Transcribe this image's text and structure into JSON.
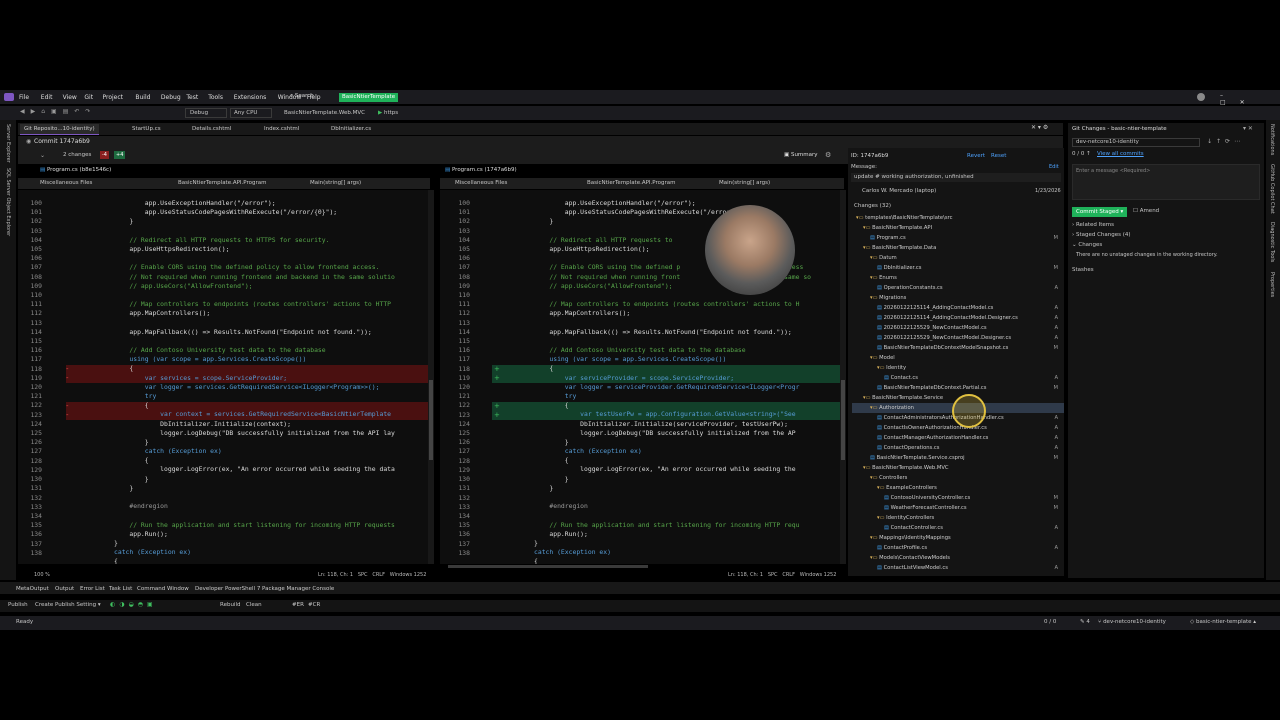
{
  "menu": [
    "File",
    "Edit",
    "View",
    "Git",
    "Project",
    "Build",
    "Debug",
    "Test",
    "Tools",
    "Extensions",
    "Window",
    "Help"
  ],
  "search_label": "Search",
  "solution_badge": "BasicNtierTemplate",
  "toolbar": {
    "config": "Debug",
    "platform": "Any CPU",
    "startup": "BasicNtierTemplate.Web.MVC",
    "run": "https"
  },
  "doc_tabs": [
    {
      "label": "Git Reposito...10-identity)",
      "active": true
    },
    {
      "label": "StartUp.cs",
      "active": false
    },
    {
      "label": "Details.cshtml",
      "active": false
    },
    {
      "label": "Index.cshtml",
      "active": false
    },
    {
      "label": "DbInitializer.cs",
      "active": false
    }
  ],
  "commit": {
    "title": "Commit 1747a6b9",
    "changes": "2 changes",
    "deletions": "-4",
    "additions": "+4",
    "summary": "Summary",
    "id": "ID: 1747a6b9",
    "revert": "Revert",
    "reset": "Reset",
    "message_label": "Message:",
    "message": "update # working authorization, unfinished",
    "edit": "Edit",
    "author": "Carlos W. Mercado (laptop)",
    "date": "1/23/2026",
    "changes_header": "Changes (32)"
  },
  "left_pane": {
    "file_tab": "Program.cs (b8e1546c)",
    "nav_project": "Miscellaneous Files",
    "nav_class": "BasicNtierTemplate.API.Program",
    "nav_member": "Main(string[] args)",
    "status": "Ln: 118, Ch: 1",
    "enc": "SPC",
    "eol": "CRLF",
    "codepage": "Windows 1252"
  },
  "right_pane": {
    "file_tab": "Program.cs (1747a6b9)",
    "nav_project": "Miscellaneous Files",
    "nav_class": "BasicNtierTemplate.API.Program",
    "nav_member": "Main(string[] args)",
    "status": "Ln: 118, Ch: 1",
    "enc": "SPC",
    "eol": "CRLF",
    "codepage": "Windows 1252"
  },
  "zoom": "100 %",
  "line_numbers": [
    "100",
    "101",
    "102",
    "103",
    "104",
    "105",
    "106",
    "107",
    "108",
    "109",
    "110",
    "111",
    "112",
    "113",
    "114",
    "115",
    "116",
    "117",
    "118",
    "119",
    "120",
    "121",
    "122",
    "123",
    "124",
    "125",
    "126",
    "127",
    "128",
    "129",
    "130",
    "131",
    "132",
    "133",
    "134",
    "135",
    "136",
    "137",
    "138"
  ],
  "left_code": [
    "        app.UseExceptionHandler(\"/error\");",
    "        app.UseStatusCodePagesWithReExecute(\"/error/{0}\");",
    "    }",
    "",
    "    // Redirect all HTTP requests to HTTPS for security.",
    "    app.UseHttpsRedirection();",
    "",
    "    // Enable CORS using the defined policy to allow frontend access.",
    "    // Not required when running frontend and backend in the same solutio",
    "    // app.UseCors(\"AllowFrontend\");",
    "",
    "    // Map controllers to endpoints (routes controllers' actions to HTTP",
    "    app.MapControllers();",
    "",
    "    app.MapFallback(() => Results.NotFound(\"Endpoint not found.\"));",
    "",
    "    // Add Contoso University test data to the database",
    "    using (var scope = app.Services.CreateScope())",
    "    {",
    "        var services = scope.ServiceProvider;",
    "        var logger = services.GetRequiredService<ILogger<Program>>();",
    "        try",
    "        {",
    "            var context = services.GetRequiredService<BasicNtierTemplate",
    "            DbInitializer.Initialize(context);",
    "            logger.LogDebug(\"DB successfully initialized from the API lay",
    "        }",
    "        catch (Exception ex)",
    "        {",
    "            logger.LogError(ex, \"An error occurred while seeding the data",
    "        }",
    "    }",
    "",
    "    #endregion",
    "",
    "    // Run the application and start listening for incoming HTTP requests",
    "    app.Run();",
    "}",
    "catch (Exception ex)",
    "{"
  ],
  "right_code": [
    "        app.UseExceptionHandler(\"/error\");",
    "        app.UseStatusCodePagesWithReExecute(\"/error/{0}\");",
    "    }",
    "",
    "    // Redirect all HTTP requests to",
    "    app.UseHttpsRedirection();",
    "",
    "    // Enable CORS using the defined p                          access",
    "    // Not required when running front                           same so",
    "    // app.UseCors(\"AllowFrontend\");",
    "",
    "    // Map controllers to endpoints (routes controllers' actions to H",
    "    app.MapControllers();",
    "",
    "    app.MapFallback(() => Results.NotFound(\"Endpoint not found.\"));",
    "",
    "    // Add Contoso University test data to the database",
    "    using (var scope = app.Services.CreateScope())",
    "    {",
    "        var serviceProvider = scope.ServiceProvider;",
    "        var logger = serviceProvider.GetRequiredService<ILogger<Progr",
    "        try",
    "        {",
    "            var testUserPw = app.Configuration.GetValue<string>(\"See",
    "            DbInitializer.Initialize(serviceProvider, testUserPw);",
    "            logger.LogDebug(\"DB successfully initialized from the AP",
    "        }",
    "        catch (Exception ex)",
    "        {",
    "            logger.LogError(ex, \"An error occurred while seeding the",
    "        }",
    "    }",
    "",
    "    #endregion",
    "",
    "    // Run the application and start listening for incoming HTTP requ",
    "    app.Run();",
    "}",
    "catch (Exception ex)",
    "{"
  ],
  "tree": [
    {
      "label": "templates\\BasicNtierTemplate\\src",
      "indent": 0,
      "status": "",
      "folder": true
    },
    {
      "label": "BasicNtierTemplate.API",
      "indent": 1,
      "status": "",
      "folder": true
    },
    {
      "label": "Program.cs",
      "indent": 2,
      "status": "M",
      "folder": false
    },
    {
      "label": "BasicNtierTemplate.Data",
      "indent": 1,
      "status": "",
      "folder": true
    },
    {
      "label": "Datum",
      "indent": 2,
      "status": "",
      "folder": true
    },
    {
      "label": "DbInitializer.cs",
      "indent": 3,
      "status": "M",
      "folder": false
    },
    {
      "label": "Enums",
      "indent": 2,
      "status": "",
      "folder": true
    },
    {
      "label": "OperationConstants.cs",
      "indent": 3,
      "status": "A",
      "folder": false
    },
    {
      "label": "Migrations",
      "indent": 2,
      "status": "",
      "folder": true
    },
    {
      "label": "20260122125114_AddingContactModel.cs",
      "indent": 3,
      "status": "A",
      "folder": false
    },
    {
      "label": "20260122125114_AddingContactModel.Designer.cs",
      "indent": 3,
      "status": "A",
      "folder": false
    },
    {
      "label": "20260122125529_NewContactModel.cs",
      "indent": 3,
      "status": "A",
      "folder": false
    },
    {
      "label": "20260122125529_NewContactModel.Designer.cs",
      "indent": 3,
      "status": "A",
      "folder": false
    },
    {
      "label": "BasicNtierTemplateDbContextModelSnapshot.cs",
      "indent": 3,
      "status": "M",
      "folder": false
    },
    {
      "label": "Model",
      "indent": 2,
      "status": "",
      "folder": true
    },
    {
      "label": "Identity",
      "indent": 3,
      "status": "",
      "folder": true
    },
    {
      "label": "Contact.cs",
      "indent": 4,
      "status": "A",
      "folder": false
    },
    {
      "label": "BasicNtierTemplateDbContext.Partial.cs",
      "indent": 3,
      "status": "M",
      "folder": false
    },
    {
      "label": "BasicNtierTemplate.Service",
      "indent": 1,
      "status": "",
      "folder": true
    },
    {
      "label": "Authorization",
      "indent": 2,
      "status": "",
      "folder": true,
      "selected": true
    },
    {
      "label": "ContactAdministratorsAuthorizationHandler.cs",
      "indent": 3,
      "status": "A",
      "folder": false
    },
    {
      "label": "ContactIsOwnerAuthorizationHandler.cs",
      "indent": 3,
      "status": "A",
      "folder": false
    },
    {
      "label": "ContactManagerAuthorizationHandler.cs",
      "indent": 3,
      "status": "A",
      "folder": false
    },
    {
      "label": "ContactOperations.cs",
      "indent": 3,
      "status": "A",
      "folder": false
    },
    {
      "label": "BasicNtierTemplate.Service.csproj",
      "indent": 2,
      "status": "M",
      "folder": false
    },
    {
      "label": "BasicNtierTemplate.Web.MVC",
      "indent": 1,
      "status": "",
      "folder": true
    },
    {
      "label": "Controllers",
      "indent": 2,
      "status": "",
      "folder": true
    },
    {
      "label": "ExampleControllers",
      "indent": 3,
      "status": "",
      "folder": true
    },
    {
      "label": "ContosoUniversityController.cs",
      "indent": 4,
      "status": "M",
      "folder": false
    },
    {
      "label": "WeatherForecastController.cs",
      "indent": 4,
      "status": "M",
      "folder": false
    },
    {
      "label": "IdentityControllers",
      "indent": 3,
      "status": "",
      "folder": true
    },
    {
      "label": "ContactController.cs",
      "indent": 4,
      "status": "A",
      "folder": false
    },
    {
      "label": "Mappings\\IdentityMappings",
      "indent": 2,
      "status": "",
      "folder": true
    },
    {
      "label": "ContactProfile.cs",
      "indent": 3,
      "status": "A",
      "folder": false
    },
    {
      "label": "Models\\ContactViewModels",
      "indent": 2,
      "status": "",
      "folder": true
    },
    {
      "label": "ContactListViewModel.cs",
      "indent": 3,
      "status": "A",
      "folder": false
    }
  ],
  "git_changes": {
    "title": "Git Changes - basic-ntier-template",
    "branch": "dev-netcore10-identity",
    "view_all": "View all commits",
    "message_placeholder": "Enter a message <Required>",
    "commit_button": "Commit Staged",
    "amend": "Amend",
    "related": "Related Items",
    "staged": "Staged Changes (4)",
    "changes": "Changes",
    "no_unstaged": "There are no unstaged changes in the working directory.",
    "stashes": "Stashes",
    "counter": "0 / 0 ↑"
  },
  "bottom_tabs": [
    "MetaOutput",
    "Output",
    "Error List",
    "Task List",
    "Command Window",
    "Developer PowerShell 7",
    "Package Manager Console"
  ],
  "publish": {
    "publish": "Publish",
    "profile": "Create Publish Setting",
    "rebuild": "Rebuild",
    "clean": "Clean",
    "er": "#ER",
    "cr": "#CR"
  },
  "status_bar": {
    "ready": "Ready",
    "errors": "0 / 0",
    "pull": "4",
    "branch": "dev-netcore10-identity",
    "repo": "basic-ntier-template"
  },
  "side_left": [
    "Server Explorer",
    "SQL Server Object Explorer"
  ],
  "side_right": [
    "Notifications",
    "GitHub Copilot Chat",
    "Diagnostic Tools",
    "Properties"
  ],
  "colors": {
    "accent": "#1fb25a",
    "del": "#5a1414",
    "del_strong": "#8a1f1f",
    "add": "#124a2c",
    "add_strong": "#1d6b3f",
    "vs_purple": "#7e57c2"
  }
}
